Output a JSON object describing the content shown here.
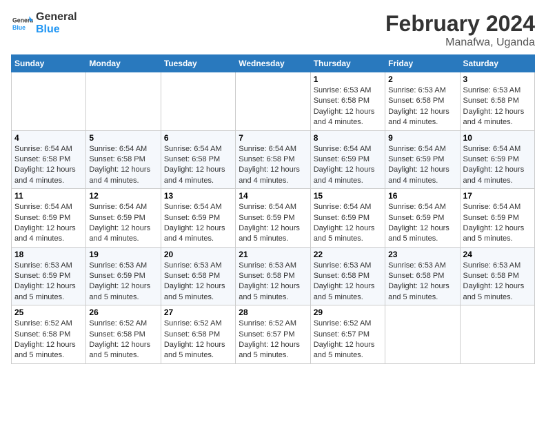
{
  "header": {
    "logo_line1": "General",
    "logo_line2": "Blue",
    "title": "February 2024",
    "location": "Manafwa, Uganda"
  },
  "days_of_week": [
    "Sunday",
    "Monday",
    "Tuesday",
    "Wednesday",
    "Thursday",
    "Friday",
    "Saturday"
  ],
  "weeks": [
    [
      {
        "day": "",
        "info": ""
      },
      {
        "day": "",
        "info": ""
      },
      {
        "day": "",
        "info": ""
      },
      {
        "day": "",
        "info": ""
      },
      {
        "day": "1",
        "info": "Sunrise: 6:53 AM\nSunset: 6:58 PM\nDaylight: 12 hours\nand 4 minutes."
      },
      {
        "day": "2",
        "info": "Sunrise: 6:53 AM\nSunset: 6:58 PM\nDaylight: 12 hours\nand 4 minutes."
      },
      {
        "day": "3",
        "info": "Sunrise: 6:53 AM\nSunset: 6:58 PM\nDaylight: 12 hours\nand 4 minutes."
      }
    ],
    [
      {
        "day": "4",
        "info": "Sunrise: 6:54 AM\nSunset: 6:58 PM\nDaylight: 12 hours\nand 4 minutes."
      },
      {
        "day": "5",
        "info": "Sunrise: 6:54 AM\nSunset: 6:58 PM\nDaylight: 12 hours\nand 4 minutes."
      },
      {
        "day": "6",
        "info": "Sunrise: 6:54 AM\nSunset: 6:58 PM\nDaylight: 12 hours\nand 4 minutes."
      },
      {
        "day": "7",
        "info": "Sunrise: 6:54 AM\nSunset: 6:58 PM\nDaylight: 12 hours\nand 4 minutes."
      },
      {
        "day": "8",
        "info": "Sunrise: 6:54 AM\nSunset: 6:59 PM\nDaylight: 12 hours\nand 4 minutes."
      },
      {
        "day": "9",
        "info": "Sunrise: 6:54 AM\nSunset: 6:59 PM\nDaylight: 12 hours\nand 4 minutes."
      },
      {
        "day": "10",
        "info": "Sunrise: 6:54 AM\nSunset: 6:59 PM\nDaylight: 12 hours\nand 4 minutes."
      }
    ],
    [
      {
        "day": "11",
        "info": "Sunrise: 6:54 AM\nSunset: 6:59 PM\nDaylight: 12 hours\nand 4 minutes."
      },
      {
        "day": "12",
        "info": "Sunrise: 6:54 AM\nSunset: 6:59 PM\nDaylight: 12 hours\nand 4 minutes."
      },
      {
        "day": "13",
        "info": "Sunrise: 6:54 AM\nSunset: 6:59 PM\nDaylight: 12 hours\nand 4 minutes."
      },
      {
        "day": "14",
        "info": "Sunrise: 6:54 AM\nSunset: 6:59 PM\nDaylight: 12 hours\nand 5 minutes."
      },
      {
        "day": "15",
        "info": "Sunrise: 6:54 AM\nSunset: 6:59 PM\nDaylight: 12 hours\nand 5 minutes."
      },
      {
        "day": "16",
        "info": "Sunrise: 6:54 AM\nSunset: 6:59 PM\nDaylight: 12 hours\nand 5 minutes."
      },
      {
        "day": "17",
        "info": "Sunrise: 6:54 AM\nSunset: 6:59 PM\nDaylight: 12 hours\nand 5 minutes."
      }
    ],
    [
      {
        "day": "18",
        "info": "Sunrise: 6:53 AM\nSunset: 6:59 PM\nDaylight: 12 hours\nand 5 minutes."
      },
      {
        "day": "19",
        "info": "Sunrise: 6:53 AM\nSunset: 6:59 PM\nDaylight: 12 hours\nand 5 minutes."
      },
      {
        "day": "20",
        "info": "Sunrise: 6:53 AM\nSunset: 6:58 PM\nDaylight: 12 hours\nand 5 minutes."
      },
      {
        "day": "21",
        "info": "Sunrise: 6:53 AM\nSunset: 6:58 PM\nDaylight: 12 hours\nand 5 minutes."
      },
      {
        "day": "22",
        "info": "Sunrise: 6:53 AM\nSunset: 6:58 PM\nDaylight: 12 hours\nand 5 minutes."
      },
      {
        "day": "23",
        "info": "Sunrise: 6:53 AM\nSunset: 6:58 PM\nDaylight: 12 hours\nand 5 minutes."
      },
      {
        "day": "24",
        "info": "Sunrise: 6:53 AM\nSunset: 6:58 PM\nDaylight: 12 hours\nand 5 minutes."
      }
    ],
    [
      {
        "day": "25",
        "info": "Sunrise: 6:52 AM\nSunset: 6:58 PM\nDaylight: 12 hours\nand 5 minutes."
      },
      {
        "day": "26",
        "info": "Sunrise: 6:52 AM\nSunset: 6:58 PM\nDaylight: 12 hours\nand 5 minutes."
      },
      {
        "day": "27",
        "info": "Sunrise: 6:52 AM\nSunset: 6:58 PM\nDaylight: 12 hours\nand 5 minutes."
      },
      {
        "day": "28",
        "info": "Sunrise: 6:52 AM\nSunset: 6:57 PM\nDaylight: 12 hours\nand 5 minutes."
      },
      {
        "day": "29",
        "info": "Sunrise: 6:52 AM\nSunset: 6:57 PM\nDaylight: 12 hours\nand 5 minutes."
      },
      {
        "day": "",
        "info": ""
      },
      {
        "day": "",
        "info": ""
      }
    ]
  ]
}
